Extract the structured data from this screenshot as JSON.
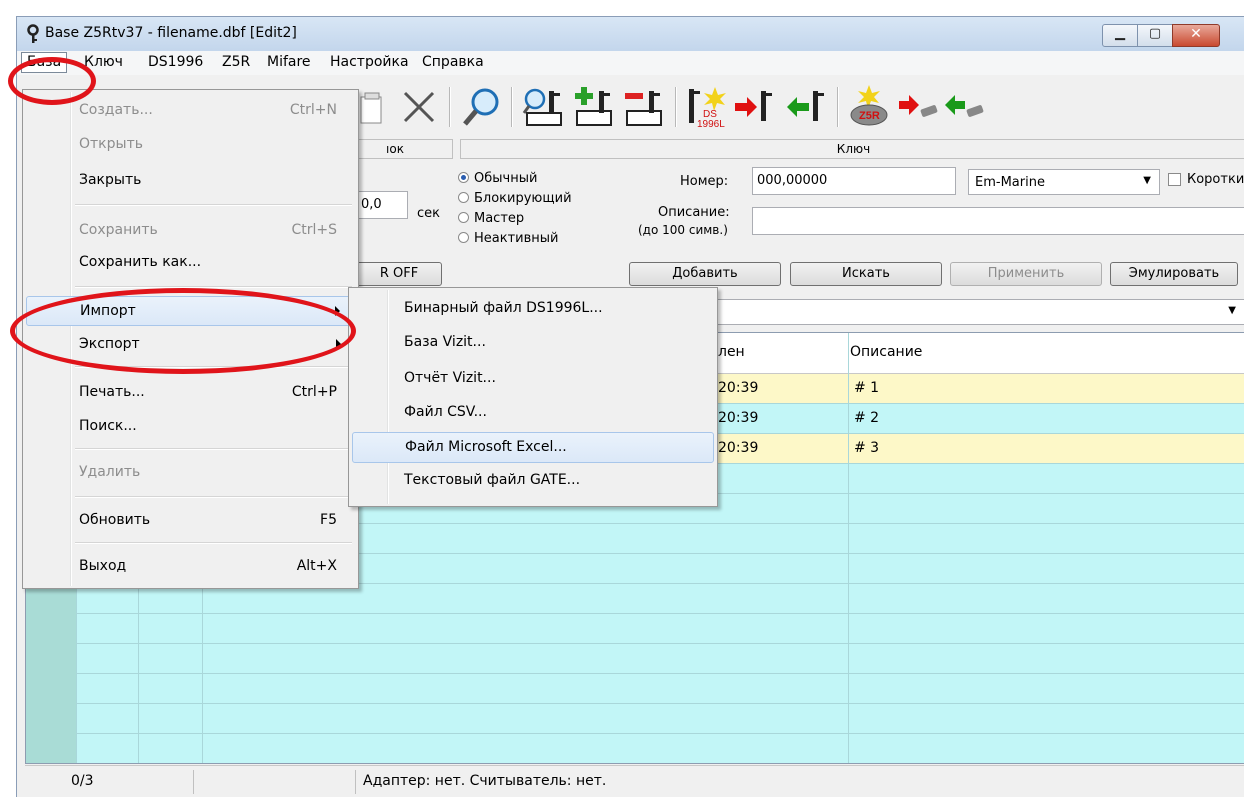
{
  "window": {
    "title": "Base Z5Rtv37 - filename.dbf [Edit2]",
    "controls": {
      "minimize": "▁",
      "maximize": "▢",
      "close": "✕"
    }
  },
  "menubar": [
    "База",
    "Ключ",
    "DS1996",
    "Z5R",
    "Mifare",
    "Настройка",
    "Справка"
  ],
  "toolbar": {
    "icons": [
      "new-doc-icon",
      "delete-icon",
      "search-icon",
      "find-key-icon",
      "add-key-icon",
      "remove-key-icon",
      "ds1996-icon",
      "write-key-icon",
      "read-key-icon",
      "z5r-icon",
      "write-chip-icon",
      "read-chip-icon"
    ],
    "ds_label": "DS\n1996L",
    "z5r_label": "Z5R"
  },
  "lock_panel": {
    "header": "ıок",
    "time_value": "0,0",
    "time_unit": "сек",
    "relay_button": "R OFF"
  },
  "key_panel": {
    "header": "Ключ",
    "types": [
      {
        "label": "Обычный",
        "selected": true
      },
      {
        "label": "Блокирующий",
        "selected": false
      },
      {
        "label": "Мастер",
        "selected": false
      },
      {
        "label": "Неактивный",
        "selected": false
      }
    ],
    "number_label": "Номер:",
    "number_value": "000,00000",
    "key_type_value": "Em-Marine",
    "short_label": "Короткий",
    "description_label": "Описание:",
    "description_hint": "(до 100 симв.)",
    "description_value": "",
    "buttons": {
      "add": "Добавить",
      "find": "Искать",
      "apply": "Применить",
      "emulate": "Эмулировать"
    }
  },
  "grid": {
    "headers": {
      "changed": "лен",
      "description": "Описание"
    },
    "rows": [
      {
        "changed": "20:39",
        "description": "# 1"
      },
      {
        "changed": "20:39",
        "description": "# 2"
      },
      {
        "changed": "20:39",
        "description": "# 3"
      }
    ]
  },
  "statusbar": {
    "count": "0/3",
    "message": "Адаптер: нет. Считыватель: нет."
  },
  "menu": {
    "items": [
      {
        "label": "Создать...",
        "shortcut": "Ctrl+N",
        "disabled": true
      },
      {
        "label": "Открыть",
        "shortcut": "",
        "disabled": true
      },
      {
        "label": "Закрыть",
        "shortcut": "",
        "disabled": false
      },
      {
        "label": "Сохранить",
        "shortcut": "Ctrl+S",
        "disabled": true
      },
      {
        "label": "Сохранить как...",
        "shortcut": "",
        "disabled": false
      },
      {
        "label": "Импорт",
        "shortcut": "",
        "disabled": false
      },
      {
        "label": "Экспорт",
        "shortcut": "",
        "disabled": false
      },
      {
        "label": "Печать...",
        "shortcut": "Ctrl+P",
        "disabled": false
      },
      {
        "label": "Поиск...",
        "shortcut": "",
        "disabled": false
      },
      {
        "label": "Удалить",
        "shortcut": "",
        "disabled": true
      },
      {
        "label": "Обновить",
        "shortcut": "F5",
        "disabled": false
      },
      {
        "label": "Выход",
        "shortcut": "Alt+X",
        "disabled": false
      }
    ]
  },
  "submenu": {
    "items": [
      "Бинарный файл DS1996L...",
      "База Vizit...",
      "Отчёт Vizit...",
      "Файл CSV...",
      "Файл Microsoft Excel...",
      "Текстовый файл GATE..."
    ]
  },
  "colors": {
    "grid_bg": "#c2f6f7",
    "row_alt": "#fdf8c8",
    "annotation": "#e0141a",
    "highlight": "#dbe8f8"
  }
}
